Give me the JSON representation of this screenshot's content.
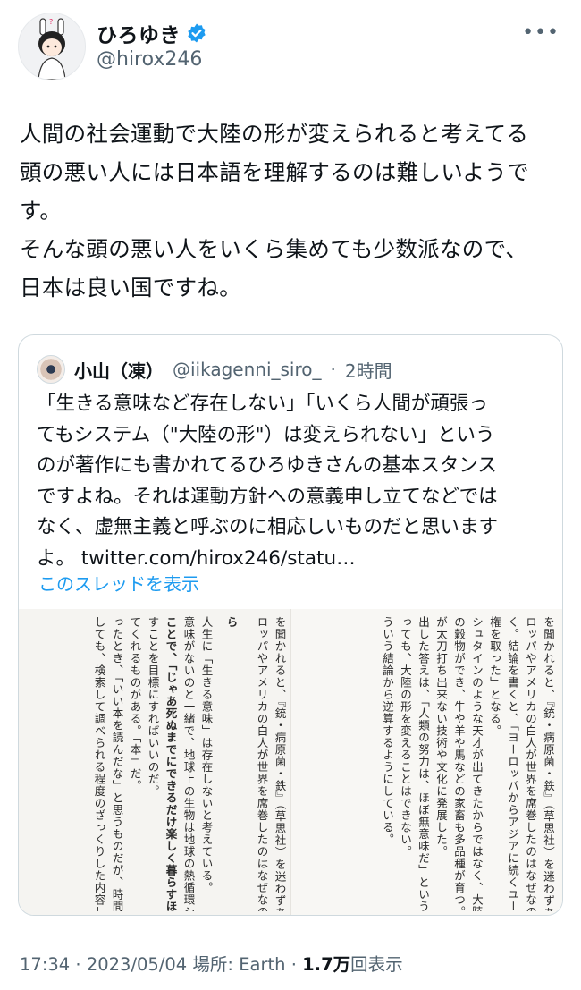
{
  "author": {
    "name": "ひろゆき",
    "handle": "@hirox246",
    "verified_color": "#1d9bf0",
    "more_icon": "more-dots-icon"
  },
  "tweet": {
    "text": "人間の社会運動で大陸の形が変えられると考えてる\n頭の悪い人には日本語を理解するのは難しいようで\nす。\nそんな頭の悪い人をいくら集めても少数派なので、\n日本は良い国ですね。"
  },
  "quote": {
    "name": "小山（凍）",
    "handle": "@iikagenni_siro_",
    "sep": "·",
    "time": "2時間",
    "text": "「生きる意味など存在しない」「いくら人間が頑張っ\nてもシステム（\"大陸の形\"）は変えられない」という\nのが著作にも書かれてるひろゆきさんの基本スタンス\nですよね。それは運動方針への意義申し立てなどでは\nなく、虚無主義と呼ぶのに相応しいものだと思います\nよ。 twitter.com/hirox246/statu…",
    "thread_link": "このスレッドを表示",
    "image": {
      "left_page": [
        "ら",
        "人生に「生きる意味」は存在しないと考えている。",
        "意味がないのと一緒で、地球上の生物は地球の熱循環システムの一部と",
        "ことで、「じゃあ死ぬまでにできるだけ楽しく暮らすほうがいいな」と",
        "すことを目標にすればいいのだ。",
        "てくれるものがある。「本」だ。",
        "ったとき、「いい本を読んだな」と思うものだが、時間が経つと中身は",
        "しても、検索して調べられる程度のざっくりした内容しか頭の中には残"
      ],
      "right_page": [
        "を聞かれると、『銃・病原菌・鉄』（草思社）を迷わずあげる。",
        "ロッパやアメリカの白人が世界を席巻したのはなぜなのか？」という問",
        "く。結論を書くと、「ヨーロッパからアジアに続くユーラシア大陸が東",
        "権を取った」となる。",
        "シュタインのような天才が出てきたからではなく、大陸が横に長いと、",
        "の穀物ができ、牛や羊や馬などの家畜も多品種が育つ。それによる差が",
        "が太刀打ち出来ない技術や文化に発展した。",
        "出した答えは、「人類の努力は、ほぼ無意味だ」ということだ。",
        "っても、大陸の形を変えることはできない。",
        "ういう結論から逆算するようにしている。"
      ],
      "edge_page": [
        "を聞かれると、『銃・病原菌・鉄』（草思社）を迷わずあげる。",
        "ロッパやアメリカの白人が世界を席巻したのはなぜなのか？」という問"
      ]
    }
  },
  "meta": {
    "time": "17:34",
    "date": "2023/05/04",
    "place_label": "場所: Earth",
    "views": "1.7万",
    "views_label": "回表示",
    "dot": "·"
  }
}
